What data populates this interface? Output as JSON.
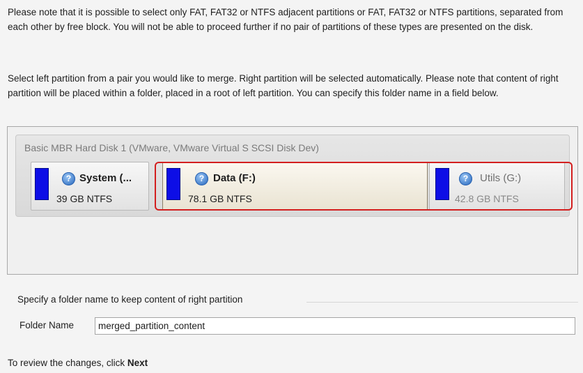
{
  "instructions": {
    "paragraph1": "Please note that it is possible to select only FAT, FAT32 or NTFS adjacent partitions or FAT, FAT32 or NTFS partitions, separated from each other by free block. You will not be able to proceed further if no pair of partitions of these types are presented on the disk.",
    "paragraph2": "Select left partition from a pair you would like to merge. Right partition will be selected automatically. Please note that content of right partition will be placed within a folder, placed in a root of left partition. You can specify this folder name in a field below."
  },
  "disk": {
    "title": "Basic MBR Hard Disk 1 (VMware, VMware Virtual S SCSI Disk Dev)",
    "partitions": [
      {
        "name": "System (...",
        "size": "39 GB NTFS",
        "state": "normal"
      },
      {
        "name": "Data (F:)",
        "size": "78.1 GB NTFS",
        "state": "selected"
      },
      {
        "name": "Utils (G:)",
        "size": "42.8 GB NTFS",
        "state": "auto-selected"
      }
    ],
    "selection_color": "#d31f1f",
    "partition_bar_color": "#0d0ee6"
  },
  "folder": {
    "group_label": "Specify a folder name to keep content of right partition",
    "field_label": "Folder Name",
    "value": "merged_partition_content"
  },
  "footer": {
    "text": "To review the changes, click ",
    "emphasis": "Next"
  },
  "icons": {
    "partition_help": "help-question-icon"
  }
}
